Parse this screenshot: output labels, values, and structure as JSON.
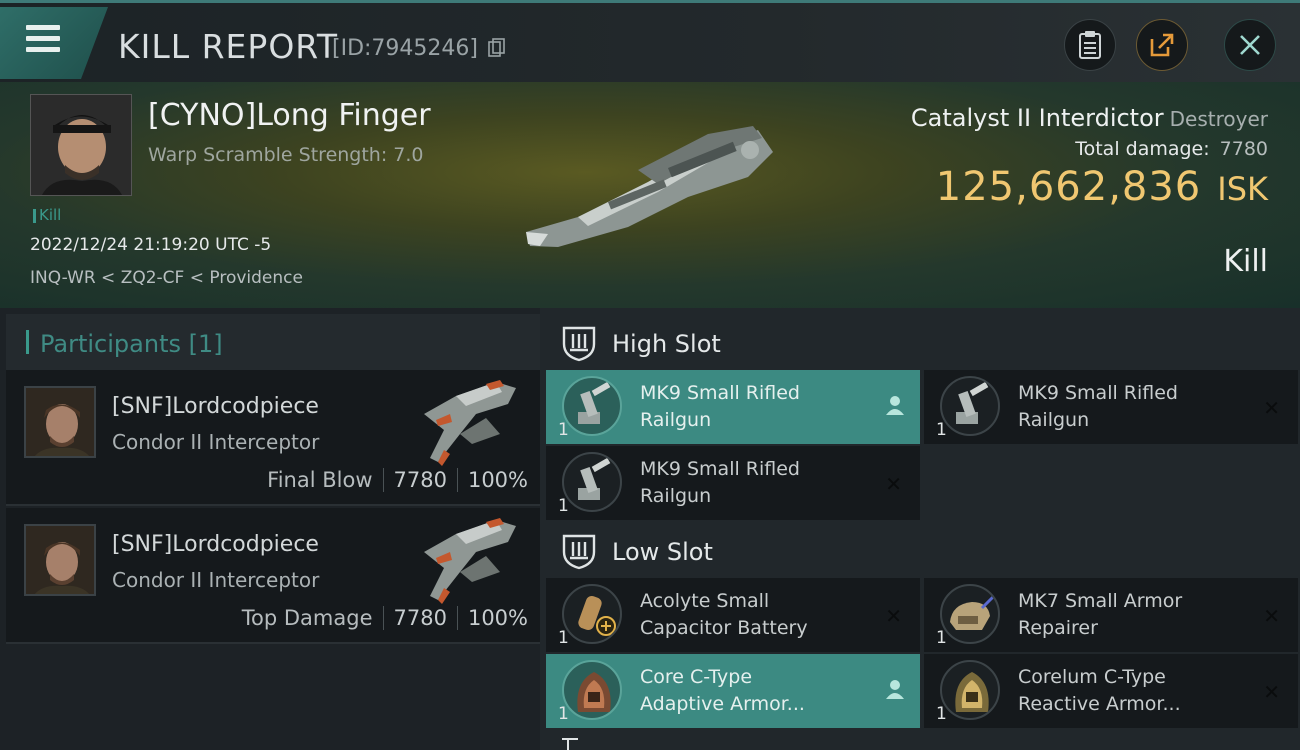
{
  "header": {
    "title": "KILL REPORT",
    "report_id": "[ID:7945246]"
  },
  "victim": {
    "name": "[CYNO]Long Finger",
    "scram_strength": "Warp Scramble Strength: 7.0",
    "tag": "Kill",
    "datetime": "2022/12/24 21:19:20 UTC -5",
    "location": "INQ-WR < ZQ2-CF < Providence",
    "ship_name": "Catalyst II Interdictor",
    "ship_class": "Destroyer",
    "total_damage_label": "Total damage:",
    "total_damage": "7780",
    "isk_value": "125,662,836",
    "isk_unit": "ISK",
    "result": "Kill"
  },
  "participants": {
    "title": "Participants [1]",
    "list": [
      {
        "name": "[SNF]Lordcodpiece",
        "ship": "Condor II Interceptor",
        "role": "Final Blow",
        "damage": "7780",
        "percent": "100%"
      },
      {
        "name": "[SNF]Lordcodpiece",
        "ship": "Condor II Interceptor",
        "role": "Top Damage",
        "damage": "7780",
        "percent": "100%"
      }
    ]
  },
  "fitting": {
    "high_slot": {
      "label": "High Slot",
      "modules": [
        {
          "name_line1": "MK9 Small Rifled",
          "name_line2": "Railgun",
          "qty": "1",
          "status": "pilot-icon"
        },
        {
          "name_line1": "MK9 Small Rifled",
          "name_line2": "Railgun",
          "qty": "1",
          "status": "✕"
        },
        {
          "name_line1": "MK9 Small Rifled",
          "name_line2": "Railgun",
          "qty": "1",
          "status": "✕"
        }
      ]
    },
    "low_slot": {
      "label": "Low Slot",
      "modules": [
        {
          "name_line1": "Acolyte Small",
          "name_line2": "Capacitor Battery",
          "qty": "1",
          "status": "✕"
        },
        {
          "name_line1": "MK7 Small Armor",
          "name_line2": "Repairer",
          "qty": "1",
          "status": "✕"
        },
        {
          "name_line1": "Core C-Type",
          "name_line2": "Adaptive Armor...",
          "qty": "1",
          "status": "pilot-icon"
        },
        {
          "name_line1": "Corelum C-Type",
          "name_line2": "Reactive Armor...",
          "qty": "1",
          "status": "✕"
        }
      ]
    }
  },
  "colors": {
    "accent": "#3a9a8c",
    "isk": "#f0c771",
    "highlight_row": "#3c8a82"
  }
}
